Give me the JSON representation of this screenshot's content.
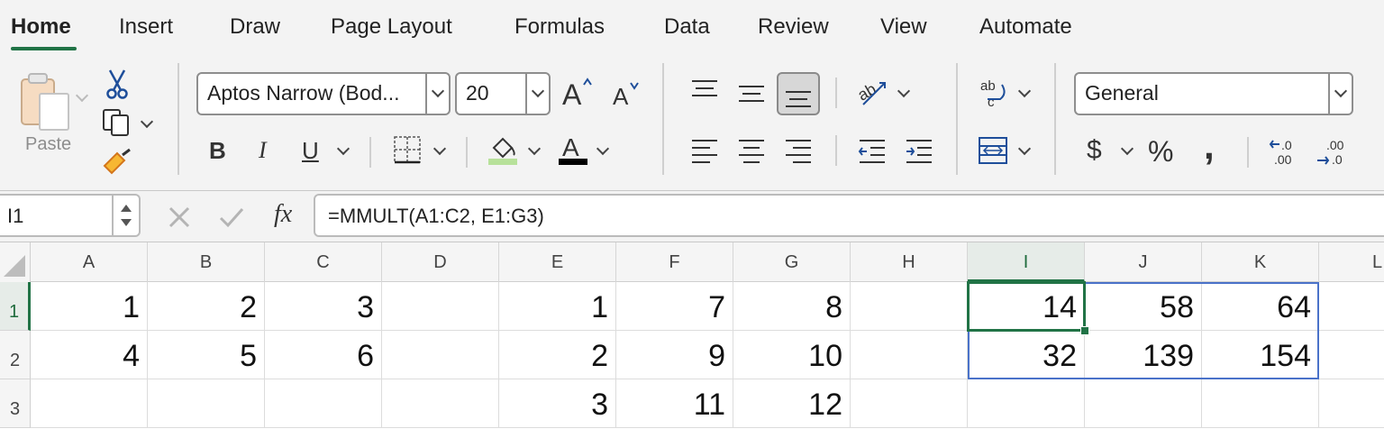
{
  "tabs": [
    "Home",
    "Insert",
    "Draw",
    "Page Layout",
    "Formulas",
    "Data",
    "Review",
    "View",
    "Automate"
  ],
  "clipboard": {
    "paste_label": "Paste"
  },
  "font": {
    "name": "Aptos Narrow (Bod...",
    "size": "20"
  },
  "font_buttons": {
    "bold": "B",
    "italic": "I",
    "underline": "U",
    "font_color_letter": "A",
    "highlight_color": "#b7e19a",
    "font_color": "#000000"
  },
  "number_format": {
    "value": "General",
    "currency_symbol": "$",
    "percent_symbol": "%",
    "comma_symbol": ","
  },
  "name_box": {
    "value": "I1"
  },
  "formula_bar": {
    "fx_label": "fx",
    "formula": "=MMULT(A1:C2, E1:G3)"
  },
  "columns": [
    "A",
    "B",
    "C",
    "D",
    "E",
    "F",
    "G",
    "H",
    "I",
    "J",
    "K",
    "L"
  ],
  "rows": [
    "1",
    "2",
    "3"
  ],
  "cells": {
    "A1": "1",
    "B1": "2",
    "C1": "3",
    "E1": "1",
    "F1": "7",
    "G1": "8",
    "I1": "14",
    "J1": "58",
    "K1": "64",
    "A2": "4",
    "B2": "5",
    "C2": "6",
    "E2": "2",
    "F2": "9",
    "G2": "10",
    "I2": "32",
    "J2": "139",
    "K2": "154",
    "E3": "3",
    "F3": "11",
    "G3": "12"
  },
  "colors": {
    "accent": "#217346",
    "spill_border": "#4a72c9"
  }
}
